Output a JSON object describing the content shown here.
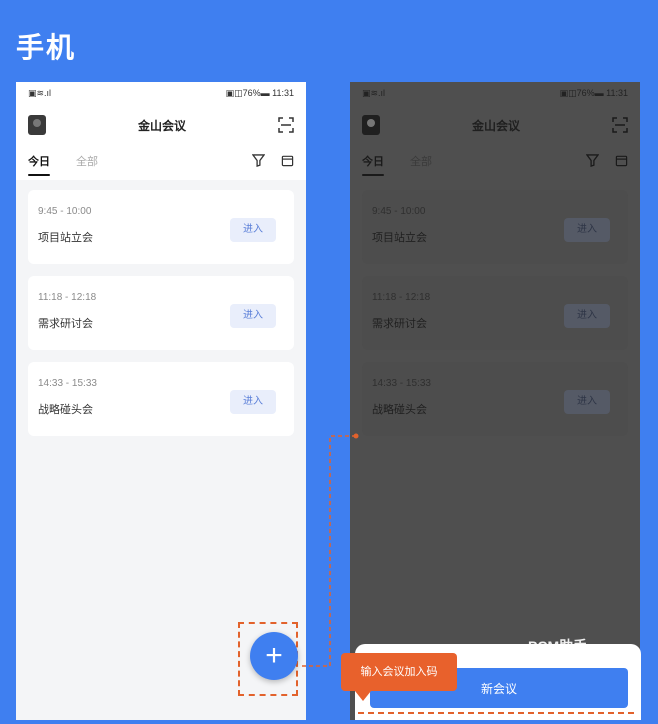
{
  "hero_title": "手机",
  "status": {
    "left": "▣≋.ıl",
    "right": "▣◫76%▬ 11:31"
  },
  "app": {
    "title": "金山会议"
  },
  "tabs": [
    {
      "label": "今日"
    },
    {
      "label": "全部"
    }
  ],
  "meetings": [
    {
      "time": "9:45 - 10:00",
      "name": "项目站立会",
      "action": "进入"
    },
    {
      "time": "11:18 - 12:18",
      "name": "需求研讨会",
      "action": "进入"
    },
    {
      "time": "14:33 - 15:33",
      "name": "战略碰头会",
      "action": "进入"
    }
  ],
  "fab_label": "+",
  "sheet": {
    "new_meeting": "新会议"
  },
  "callout": "输入会议加入码",
  "watermark": "PCM助手",
  "colors": {
    "background": "#3f7ff0",
    "accent": "#3f7ff0",
    "highlight": "#e8612c"
  },
  "icons": {
    "scan": "scan-icon",
    "filter": "filter-icon",
    "calendar": "calendar-icon",
    "avatar": "avatar"
  }
}
